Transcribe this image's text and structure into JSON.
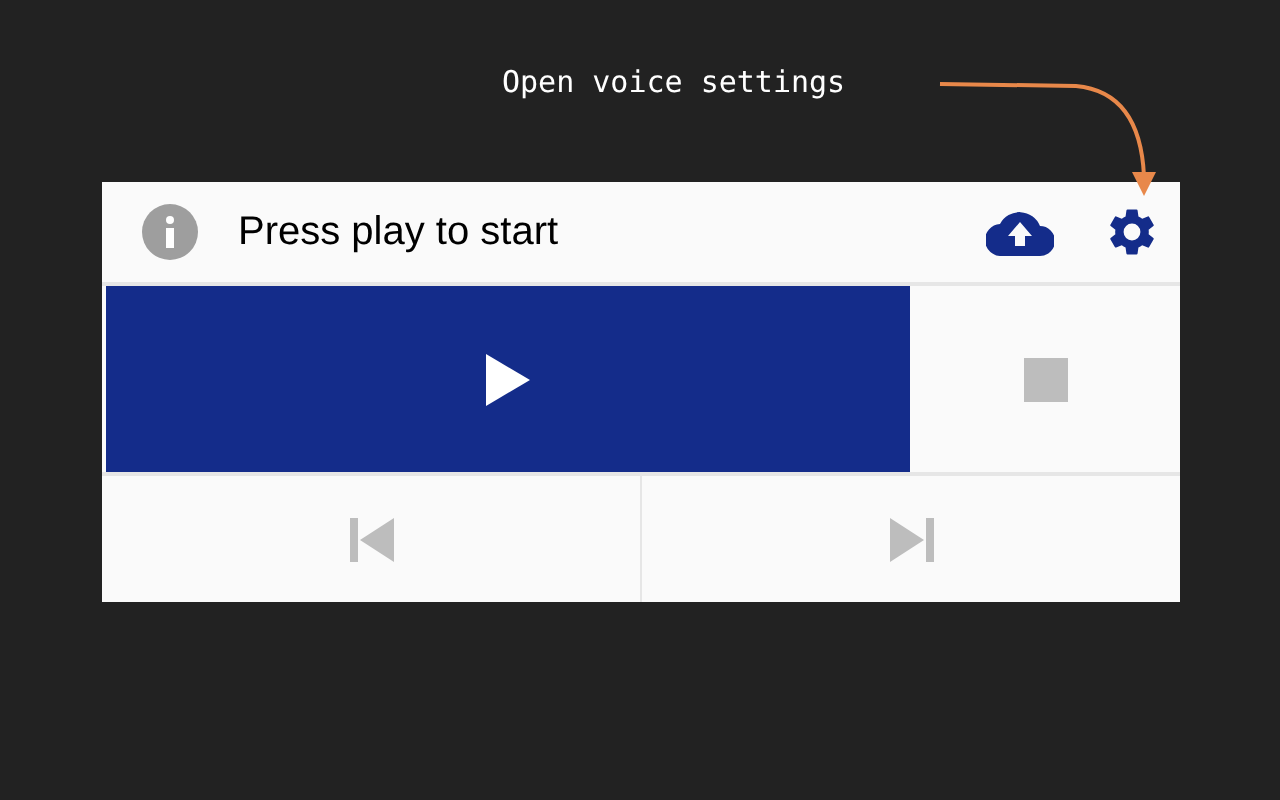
{
  "annotation": {
    "text": "Open voice settings"
  },
  "status": {
    "text": "Press play to start"
  },
  "controls": [
    {
      "kind": "play",
      "disabled": false
    },
    {
      "kind": "stop",
      "disabled": true
    },
    {
      "kind": "previous",
      "disabled": true
    },
    {
      "kind": "next",
      "disabled": true
    }
  ]
}
